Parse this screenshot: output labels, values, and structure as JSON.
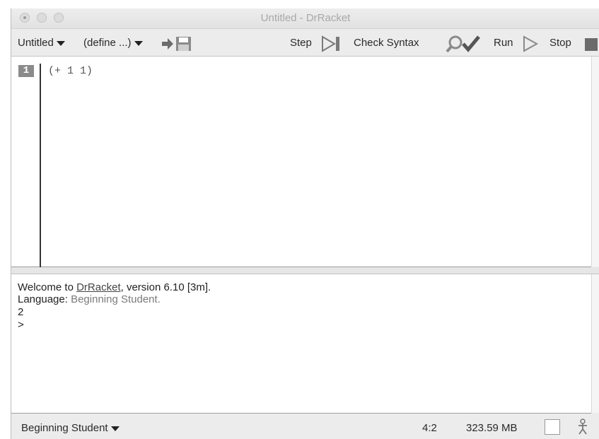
{
  "window": {
    "title": "Untitled - DrRacket"
  },
  "toolbar": {
    "file_menu": "Untitled",
    "define_menu": "(define ...)",
    "step_label": "Step",
    "check_syntax_label": "Check Syntax",
    "run_label": "Run",
    "stop_label": "Stop"
  },
  "editor": {
    "line_number": "1",
    "code": "(+ 1 1)"
  },
  "interactions": {
    "welcome_prefix": "Welcome to ",
    "welcome_link": "DrRacket",
    "welcome_suffix": ", version 6.10 [3m].",
    "language_prefix": "Language: ",
    "language_name": "Beginning Student",
    "language_suffix": ".",
    "result": "2",
    "prompt": ">"
  },
  "statusbar": {
    "language": "Beginning Student",
    "position": "4:2",
    "memory": "323.59 MB"
  },
  "icons": {
    "step": "step-icon",
    "check_syntax": "magnifier-check-icon",
    "run": "run-triangle-icon",
    "stop": "stop-square-icon",
    "save": "save-disk-icon",
    "gc": "recycling-man-icon"
  }
}
